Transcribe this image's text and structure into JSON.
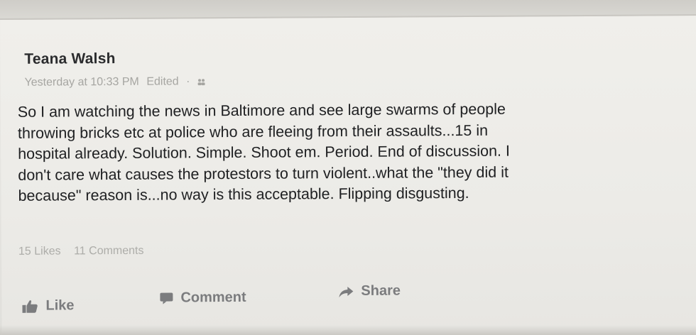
{
  "post": {
    "author": "Teana Walsh",
    "timestamp": "Yesterday at 10:33 PM",
    "edited_label": "Edited",
    "separator": "·",
    "audience_icon": "friends-icon",
    "text_lines": [
      "So I am watching the news in Baltimore and see large swarms of people",
      "throwing bricks etc at police who are fleeing from their assaults...15 in",
      "hospital already. Solution. Simple. Shoot em. Period. End of discussion. I",
      "don't care what causes the protestors to turn violent..what the \"they did it",
      "because\" reason is...no way is this acceptable. Flipping disgusting."
    ],
    "likes_count": "15 Likes",
    "comments_count": "11 Comments"
  },
  "actions": {
    "like_label": "Like",
    "comment_label": "Comment",
    "share_label": "Share"
  },
  "colors": {
    "background": "#ecebe7",
    "text": "#1f2022",
    "muted": "#a6a6a2",
    "action": "#7b7c7e"
  }
}
